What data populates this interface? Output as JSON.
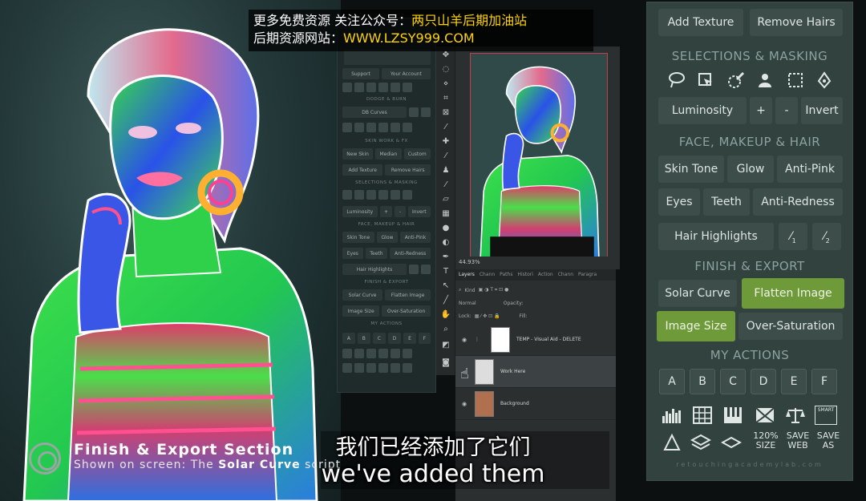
{
  "watermark": {
    "line1_prefix": "更多免费资源 关注公众号：",
    "line1_highlight": "两只山羊后期加油站",
    "line2_prefix": "后期资源网站：",
    "line2_highlight": "WWW.LZSY999.COM"
  },
  "mini_panel": {
    "top_buttons": [
      "Support",
      "Your Account"
    ],
    "heading_dodge": "DODGE & BURN",
    "db_curves": "DB Curves",
    "heading_skin": "SKIN WORK & FX",
    "row_skin": [
      "New Skin",
      "Median",
      "Custom"
    ],
    "row_texture": [
      "Add Texture",
      "Remove Hairs"
    ],
    "heading_sel": "SELECTIONS & MASKING",
    "row_lum": [
      "Luminosity",
      "+",
      "-",
      "Invert"
    ],
    "heading_face": "FACE, MAKEUP & HAIR",
    "row_face1": [
      "Skin Tone",
      "Glow",
      "Anti-Pink"
    ],
    "row_face2": [
      "Eyes",
      "Teeth",
      "Anti-Redness"
    ],
    "hair": "Hair Highlights",
    "heading_finish": "FINISH & EXPORT",
    "row_fin1": [
      "Solar Curve",
      "Flatten Image"
    ],
    "row_fin2": [
      "Image Size",
      "Over-Saturation"
    ],
    "heading_actions": "MY ACTIONS",
    "letters": [
      "A",
      "B",
      "C",
      "D",
      "E",
      "F"
    ]
  },
  "status": {
    "zoom": "44.93%"
  },
  "layers_panel": {
    "tabs": [
      "Layers",
      "Chann",
      "Paths",
      "Histori",
      "Action",
      "Chann",
      "Paragra"
    ],
    "kind": "Kind",
    "normal": "Normal",
    "opacity_label": "Opacity:",
    "lock_label": "Lock:",
    "fill_label": "Fill:",
    "layers": [
      {
        "name": "TEMP - Visual Aid - DELETE"
      },
      {
        "name": "Work Here"
      },
      {
        "name": "Background"
      }
    ]
  },
  "big_panel": {
    "row_top": [
      "Add Texture",
      "Remove Hairs"
    ],
    "heading_selections": "SELECTIONS & MASKING",
    "selection_icons": [
      "lasso-icon",
      "select-subject-icon",
      "brush-select-icon",
      "person-select-icon",
      "marquee-icon",
      "pen-icon"
    ],
    "row_lum": {
      "luminosity": "Luminosity",
      "plus": "+",
      "minus": "-",
      "invert": "Invert"
    },
    "heading_face": "FACE, MAKEUP & HAIR",
    "row_face1": [
      "Skin Tone",
      "Glow",
      "Anti-Pink"
    ],
    "row_face2": [
      "Eyes",
      "Teeth",
      "Anti-Redness"
    ],
    "hair_highlights": "Hair Highlights",
    "brush1_sub": "1",
    "brush2_sub": "2",
    "heading_finish": "FINISH & EXPORT",
    "solar_curve": "Solar Curve",
    "flatten_image": "Flatten Image",
    "image_size": "Image Size",
    "over_saturation": "Over-Saturation",
    "heading_actions": "MY ACTIONS",
    "letters": [
      "A",
      "B",
      "C",
      "D",
      "E",
      "F"
    ],
    "action_icons": [
      "histogram-icon",
      "grid-icon",
      "piano-icon",
      "envelope-icon",
      "scales-icon",
      "smart-object-icon"
    ],
    "smart_label": "SMART",
    "bottom_icons": {
      "size_120": "120%",
      "size_label": "SIZE",
      "save_web": "SAVE",
      "web": "WEB",
      "save_as": "SAVE",
      "as": "AS"
    },
    "footer": "retouchingacademylab.com"
  },
  "lower_third": {
    "title": "Finish & Export Section",
    "subtitle_prefix": "Shown on screen: The ",
    "subtitle_bold": "Solar Curve",
    "subtitle_suffix": " script"
  },
  "subtitles": {
    "chinese": "我们已经添加了它们",
    "english": "we've added them"
  },
  "colors": {
    "panel_bg": "#32423f",
    "button_bg": "#3c4d4a",
    "button_green": "#6e9a3a",
    "heading_text": "#8ba29e",
    "watermark_yellow": "#ffd400"
  }
}
